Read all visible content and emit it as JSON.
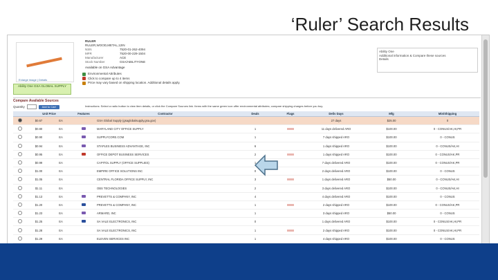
{
  "slide": {
    "title": "‘Ruler’ Search Results"
  },
  "colors": {
    "footer": "#0e3f8a",
    "selected_row": "#f6d9c6",
    "header_bg": "#dfe7f2",
    "arrow": "#b9d6ea"
  },
  "product": {
    "name": "RULER",
    "subtitle": "RULER,WOOD,METAL,12IN",
    "details": [
      {
        "k": "NSN",
        "v": "7520-01-262-4094"
      },
      {
        "k": "MFR",
        "v": "7520-00-229-1504"
      },
      {
        "k": "Manufacturer",
        "v": "ACE"
      },
      {
        "k": "Stock Number",
        "v": "GSA/ABILITYONE"
      }
    ],
    "availability": "Available on GSA Advantage",
    "image_caption": "Enlarge image | Details",
    "green_badge": "Ability One\nGSA GLOBAL SUPPLY"
  },
  "notes": [
    {
      "icon": "leaf-icon",
      "text": "Environmental Attributes"
    },
    {
      "icon": "truck-icon",
      "text": "Click to compare up to 4 items"
    },
    {
      "icon": "star-icon",
      "text": "Price may vary based on shipping location. Additional details apply."
    }
  ],
  "right_box": {
    "lines": [
      "Ability One",
      "Additional information & Compare these sources",
      "Details"
    ]
  },
  "section": {
    "title": "Compare Available Sources",
    "qty_label": "Quantity",
    "add_button": "Add to Cart",
    "instructions": "Instructions: Select a radio button to view item details, or click the Compare Sources link. Items with the same green icon offer environmental attributes; compare shipping charges before you buy."
  },
  "table": {
    "headers": [
      "Unit Price",
      "Features",
      "Contractor",
      "Deals",
      "Flags",
      "Deliv Days",
      "Mfg",
      "Min/Shipping"
    ],
    "rows": [
      {
        "price": "$0.67",
        "unit": "EA",
        "features": "none",
        "contractor": "GSA Global Supply (gsaglobalsupply.gsa.gov)",
        "deals": "",
        "delivery": "27 days",
        "mfg": "$25.00",
        "min": "0",
        "selected": true
      },
      {
        "price": "$0.80",
        "unit": "EA",
        "features": "mixed",
        "contractor": "MARYLAND CITY OFFICE SUPPLY",
        "deals": "1",
        "delivery": "11 days delivered ARO",
        "mfg": "$100.00",
        "min": "0 - CONUS/AK,HI,PR",
        "selected": false
      },
      {
        "price": "$0.90",
        "unit": "EA",
        "features": "mixed",
        "contractor": "SUPPLYCORE.COM",
        "deals": "1",
        "delivery": "7 days shipped ARO",
        "mfg": "$100.00",
        "min": "0 - CONUS",
        "selected": false
      },
      {
        "price": "$0.94",
        "unit": "EA",
        "features": "mixed",
        "contractor": "STAPLES BUSINESS ADVANTAGE, INC",
        "deals": "6",
        "delivery": "1 days shipped ARO",
        "mfg": "$100.00",
        "min": "0 - CONUS/AK,HI",
        "selected": false
      },
      {
        "price": "$0.95",
        "unit": "EA",
        "features": "red",
        "contractor": "OFFICE DEPOT BUSINESS SERVICES",
        "deals": "2",
        "delivery": "1 days shipped ARO",
        "mfg": "$100.00",
        "min": "0 - CONUS/AK,PR",
        "selected": false
      },
      {
        "price": "$0.99",
        "unit": "EA",
        "features": "none",
        "contractor": "CAPITOL SUPPLY (OFFICE SUPPLIES)",
        "deals": "1",
        "delivery": "7 days delivered ARO",
        "mfg": "$100.00",
        "min": "0 - CONUS/AK,PR",
        "selected": false
      },
      {
        "price": "$1.00",
        "unit": "EA",
        "features": "none",
        "contractor": "EMPIRE OFFICE SOLUTIONS INC",
        "deals": "0",
        "delivery": "2 days delivered ARO",
        "mfg": "$100.00",
        "min": "0 - CONUS",
        "selected": false
      },
      {
        "price": "$1.05",
        "unit": "EA",
        "features": "none",
        "contractor": "CENTRAL FLORIDA OFFICE SUPPLY, INC",
        "deals": "3",
        "delivery": "1 days delivered ARO",
        "mfg": "$50.00",
        "min": "0 - CONUS/AK,HI",
        "selected": false
      },
      {
        "price": "$1.11",
        "unit": "EA",
        "features": "none",
        "contractor": "OBS TECHNOLOGIES",
        "deals": "2",
        "delivery": "3 days delivered ARO",
        "mfg": "$100.00",
        "min": "0 - CONUS/AK,HI",
        "selected": false
      },
      {
        "price": "$1.13",
        "unit": "EA",
        "features": "mixed",
        "contractor": "PREVETTS & COMPANY, INC",
        "deals": "4",
        "delivery": "4 days delivered ARO",
        "mfg": "$100.00",
        "min": "0 - CONUS",
        "selected": false
      },
      {
        "price": "$1.20",
        "unit": "EA",
        "features": "blue",
        "contractor": "PREVETTS & COMPANY, INC",
        "deals": "1",
        "delivery": "2 days shipped ARO",
        "mfg": "$100.00",
        "min": "0 - CONUS/AK,PR",
        "selected": false
      },
      {
        "price": "$1.23",
        "unit": "EA",
        "features": "mixed",
        "contractor": "ARMARD, INC",
        "deals": "1",
        "delivery": "3 days shipped ARO",
        "mfg": "$50.00",
        "min": "0 - CONUS",
        "selected": false
      },
      {
        "price": "$1.25",
        "unit": "EA",
        "features": "blue",
        "contractor": "SA VALE ELECTRONICS, INC",
        "deals": "0",
        "delivery": "1 days delivered ARO",
        "mfg": "$100.00",
        "min": "0 - CONUS/AK,HI,PR",
        "selected": false
      },
      {
        "price": "$1.28",
        "unit": "EA",
        "features": "none",
        "contractor": "SA VALE ELECTRONICS, INC",
        "deals": "1",
        "delivery": "2 days shipped ARO",
        "mfg": "$100.00",
        "min": "0 - CONUS/AK,HI,PR",
        "selected": false
      },
      {
        "price": "$1.29",
        "unit": "EA",
        "features": "none",
        "contractor": "ELEVEN SERVICES INC",
        "deals": "1",
        "delivery": "4 days shipped ARO",
        "mfg": "$100.00",
        "min": "0 - CONUS",
        "selected": false
      }
    ]
  }
}
